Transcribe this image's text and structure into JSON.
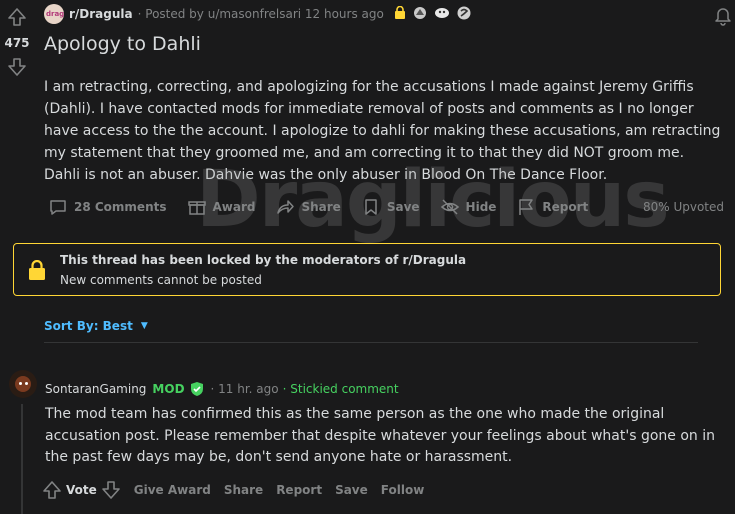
{
  "post": {
    "vote_count": "475",
    "subreddit": "r/Dragula",
    "posted_by": "· Posted by u/masonfrelsari 12 hours ago",
    "title": "Apology to Dahli",
    "body": "I am retracting, correcting, and apologizing for the accusations I made against Jeremy Griffis (Dahli). I have contacted mods for immediate removal of posts and comments as I no longer have access to the the account. I apologize to dahli for making these accusations, am retracting my statement that they groomed me, and am correcting it to that they did NOT groom me. Dahli is not an abuser. Dahvie was the only abuser in Blood On The Dance Floor.",
    "watermark": "Draglicious",
    "actions": {
      "comments": "28 Comments",
      "award": "Award",
      "share": "Share",
      "save": "Save",
      "hide": "Hide",
      "report": "Report"
    },
    "upvoted": "80% Upvoted"
  },
  "locked": {
    "title": "This thread has been locked by the moderators of r/Dragula",
    "subtitle": "New comments cannot be posted"
  },
  "sort": {
    "label": "Sort By: Best"
  },
  "comment": {
    "author": "SontaranGaming",
    "mod_badge": "MOD",
    "time": "· 11 hr. ago",
    "stickied": "· Stickied comment",
    "body": "The mod team has confirmed this as the same person as the one who made the original accusation post. Please remember that despite whatever your feelings about what's gone on in the past few days may be, don't send anyone hate or harassment.",
    "actions": {
      "vote": "Vote",
      "give_award": "Give Award",
      "share": "Share",
      "report": "Report",
      "save": "Save",
      "follow": "Follow"
    }
  },
  "colors": {
    "background": "#1a1a1b",
    "text": "#d7dadc",
    "muted": "#818384",
    "lock_yellow": "#ffd635",
    "link_blue": "#4fbcff",
    "mod_green": "#46d160"
  }
}
